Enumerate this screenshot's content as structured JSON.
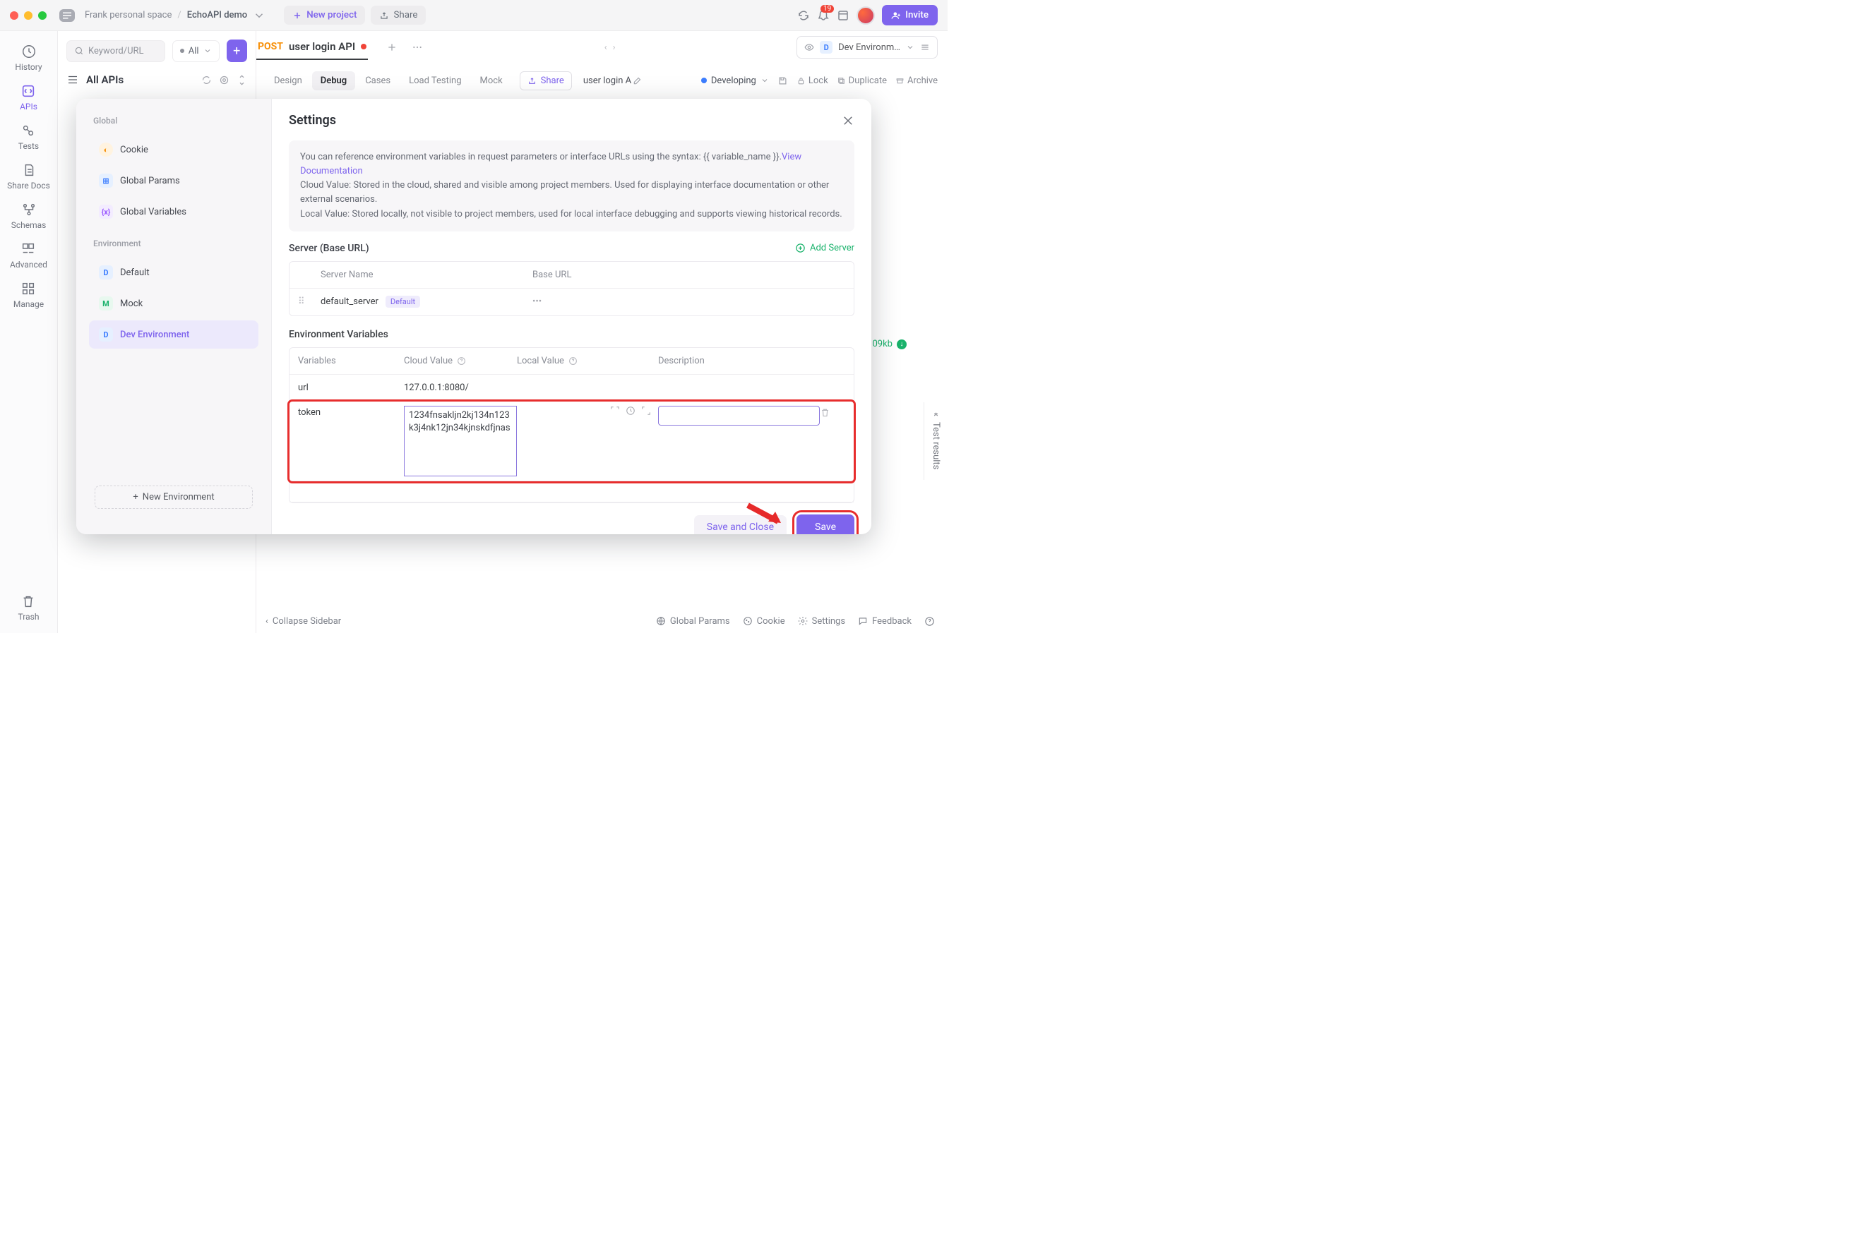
{
  "titlebar": {
    "workspace": "Frank personal space",
    "project": "EchoAPI demo",
    "new_project": "New project",
    "share": "Share",
    "invite": "Invite",
    "notif_count": "19"
  },
  "rail": {
    "history": "History",
    "apis": "APIs",
    "tests": "Tests",
    "share_docs": "Share Docs",
    "schemas": "Schemas",
    "advanced": "Advanced",
    "manage": "Manage",
    "trash": "Trash"
  },
  "sidebar": {
    "search_placeholder": "Keyword/URL",
    "filter_label": "All",
    "all_apis": "All APIs"
  },
  "tab": {
    "method": "POST",
    "name": "user login API"
  },
  "envselect": "Dev Environm…",
  "subbar": {
    "design": "Design",
    "debug": "Debug",
    "cases": "Cases",
    "load": "Load Testing",
    "mock": "Mock",
    "share": "Share",
    "api_name": "user login A",
    "dev": "Developing",
    "lock": "Lock",
    "duplicate": "Duplicate",
    "archive": "Archive"
  },
  "modal": {
    "title": "Settings",
    "side_global": "Global",
    "side_cookie": "Cookie",
    "side_gp": "Global Params",
    "side_gv": "Global Variables",
    "side_env_hdr": "Environment",
    "side_default": "Default",
    "side_mock": "Mock",
    "side_dev": "Dev Environment",
    "new_env": "New Environment",
    "info_line1": "You can reference environment variables in request parameters or interface URLs using the syntax: {{ variable_name }}.",
    "info_view_doc": "View Documentation",
    "info_line2": "Cloud Value: Stored in the cloud, shared and visible among project members. Used for displaying interface documentation or other external scenarios.",
    "info_line3": "Local Value: Stored locally, not visible to project members, used for local interface debugging and supports viewing historical records.",
    "server_hdr": "Server (Base URL)",
    "add_server": "Add Server",
    "th_server_name": "Server Name",
    "th_base_url": "Base URL",
    "default_server": "default_server",
    "default_tag": "Default",
    "envvar_hdr": "Environment Variables",
    "th_variables": "Variables",
    "th_cloud": "Cloud Value",
    "th_local": "Local Value",
    "th_desc": "Description",
    "row1_var": "url",
    "row1_cloud": "127.0.0.1:8080/",
    "row2_var": "token",
    "row2_cloud": "1234fnsakljn2kj134n123k3j4nk12jn34kjnskdfjnas",
    "btn_sac": "Save and Close",
    "btn_save": "Save"
  },
  "statusbar": {
    "collapse": "Collapse Sidebar",
    "gp": "Global Params",
    "cookie": "Cookie",
    "settings": "Settings",
    "feedback": "Feedback"
  },
  "sizebadge": "09kb",
  "vtab": "Test results"
}
